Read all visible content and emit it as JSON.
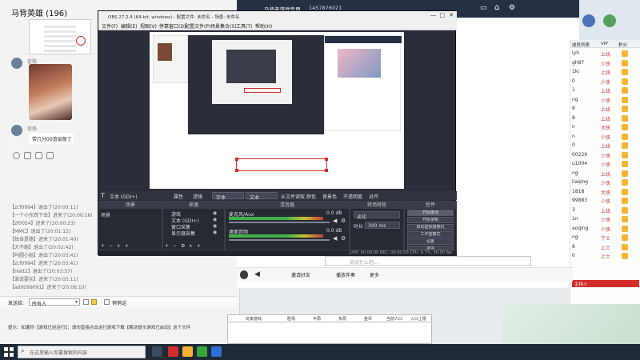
{
  "chat": {
    "title": "马背英雄 (196)",
    "sender1": "管路",
    "sender2": "管路",
    "message": "带几分00追层般了",
    "log": [
      "【zcf0994】退出了(20:00:11)",
      "【一个小东西下去】进来了(20:00:16)",
      "【zf0054】进来了(20:00:23)",
      "【MMC】退出了(20:01:12)",
      "【独自是路】进来了(20:01:40)",
      "【大不朝】退出了(20:02:42)",
      "【吗圆小姐】退出了(20:03:41)",
      "【zcf0994】进来了(20:03:41)",
      "【Hatt2】退出了(20:03:57)",
      "【谁说要买】进来了(20:05:11)",
      "【ad0099091】进来了(20:06:10)"
    ],
    "send_label": "发送给:",
    "send_target": "所有人",
    "private_label": "悄悄话",
    "tip": "提示：如遭你【游戏已经运行】；请勿直接点击运行游戏下载【解决提示游戏已启动】这个文件"
  },
  "obs": {
    "title": "OBS 27.2.4 (64-bit, windows) - 配置文件: 未命名 - 场景: 未命名",
    "menu": [
      "文件(F)",
      "编辑(E)",
      "视图(V)",
      "停靠窗口(D)",
      "配置文件(P)",
      "场景集合(S)",
      "工具(T)",
      "帮助(H)"
    ],
    "source_bar": {
      "text_source": "文本 (GDI+)",
      "props": "属性",
      "filters": "滤镜",
      "font": "字体",
      "text": "文本",
      "read_file": "从文件读取",
      "color": "颜色",
      "bg_color": "背景色",
      "opacity": "不透明度",
      "alignment": "对齐"
    },
    "scenes_title": "场景",
    "scene_item": "场景",
    "sources_title": "来源",
    "sources": [
      "游戏",
      "文本 (GDI+)",
      "窗口采集",
      "显示器采集"
    ],
    "mixer_title": "混音器",
    "mixer": [
      {
        "name": "麦克风/Aux",
        "db": "0.0 dB"
      },
      {
        "name": "桌面音频",
        "db": "0.0 dB"
      }
    ],
    "transition_title": "转场特效",
    "transition_type": "淡化",
    "duration_label": "时长",
    "duration_value": "300 ms",
    "controls_title": "控件",
    "controls": [
      "开始推流",
      "开始录制",
      "启动虚拟摄像机",
      "工作室模式",
      "设置",
      "退出"
    ],
    "status": "LIVE: 00:00:00   REC: 00:00:00   CPU: 0.7%, 30.00 fps"
  },
  "live": {
    "room_title": "马背老游戏专用",
    "room_id": "1457876021",
    "input_placeholder": "说点什么吧...",
    "bottom_buttons": [
      "邀请好友",
      "播放伴奏",
      "更多"
    ],
    "user_panel_header": [
      "成员列表",
      "VIP",
      "积分"
    ],
    "users": [
      {
        "name": "lyh",
        "status": "上线"
      },
      {
        "name": "gh87",
        "status": "少侠"
      },
      {
        "name": "1ki",
        "status": "上线"
      },
      {
        "name": "0",
        "status": "少侠"
      },
      {
        "name": "1",
        "status": "上线"
      },
      {
        "name": "ng",
        "status": "少侠"
      },
      {
        "name": "8",
        "status": "上线"
      },
      {
        "name": "8",
        "status": "上线"
      },
      {
        "name": "n",
        "status": "大侠"
      },
      {
        "name": "n",
        "status": "少侠"
      },
      {
        "name": "0",
        "status": "上线"
      },
      {
        "name": "00229",
        "status": "少侠"
      },
      {
        "name": "u1004",
        "status": "少侠"
      },
      {
        "name": "ng",
        "status": "上线"
      },
      {
        "name": "liaqing",
        "status": "少侠"
      },
      {
        "name": "1818",
        "status": "大侠"
      },
      {
        "name": "99883",
        "status": "少侠"
      },
      {
        "name": "3",
        "status": "上线"
      },
      {
        "name": "1n",
        "status": "少侠"
      },
      {
        "name": "aoqing",
        "status": "少侠"
      },
      {
        "name": "ng",
        "status": "下士"
      },
      {
        "name": "8",
        "status": "上士"
      },
      {
        "name": "0",
        "status": "上士"
      }
    ],
    "host_label": "主持人"
  },
  "table": {
    "headers": [
      "玩家游戏",
      "胜场",
      "平局",
      "负局",
      "金币",
      "当前人口",
      "入口上限"
    ]
  },
  "taskbar": {
    "search_placeholder": "在这里输入你要搜索的内容"
  },
  "colors": {
    "obs_bg": "#2b2e38",
    "taskbar": "#1f2a36",
    "live_top": "#263044",
    "accent_red": "#d42b2b"
  }
}
